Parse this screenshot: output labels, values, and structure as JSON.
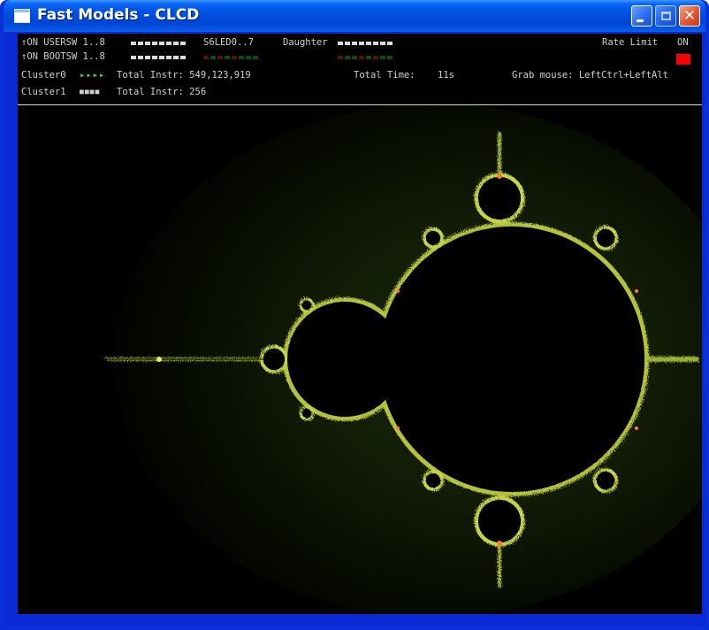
{
  "window": {
    "title": "Fast Models - CLCD"
  },
  "status": {
    "usersw_label": "↑ON USERSW 1..8",
    "bootsw_label": "↑ON BOOTSW 1..8",
    "s6led_label": "S6LED0..7",
    "daughter_label": "Daughter",
    "rate_limit_label": "Rate Limit",
    "rate_limit_value": "ON",
    "cluster0_label": "Cluster0",
    "cluster0_instr": "Total Instr: 549,123,919",
    "cluster1_label": "Cluster1",
    "cluster1_instr": "Total Instr: 256",
    "total_time_label": "Total Time:",
    "total_time_value": "11s",
    "grab_mouse": "Grab mouse: LeftCtrl+LeftAlt",
    "cluster0_run_glyphs": "▸▸▸▸",
    "cluster1_idle_glyphs": "■■■■"
  },
  "colors": {
    "titlebar": "#0054e3",
    "client_bg": "#000000",
    "status_text": "#cfcfcf",
    "rate_led": "#ff0000",
    "running_arrows": "#3cdc3c"
  },
  "icons": {
    "app": "window-icon",
    "minimize": "minimize-icon",
    "maximize": "maximize-icon",
    "close": "close-icon"
  }
}
